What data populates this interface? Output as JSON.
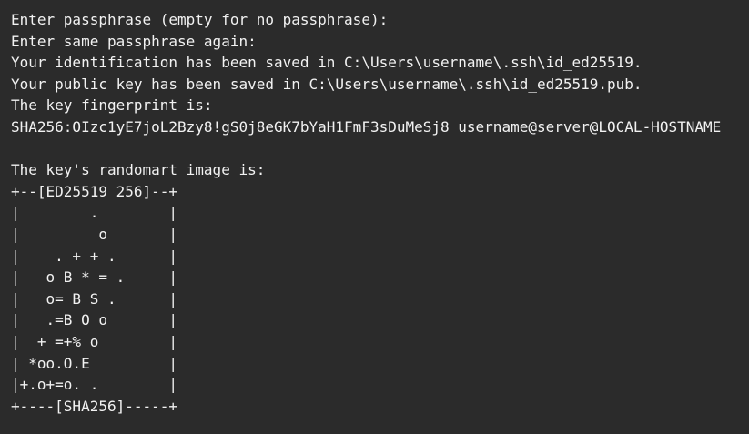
{
  "colors": {
    "background": "#2b2b2b",
    "text": "#f2f2f2"
  },
  "terminal": {
    "lines": [
      "Enter passphrase (empty for no passphrase):",
      "Enter same passphrase again:",
      "Your identification has been saved in C:\\Users\\username\\.ssh\\id_ed25519.",
      "Your public key has been saved in C:\\Users\\username\\.ssh\\id_ed25519.pub.",
      "The key fingerprint is:",
      "SHA256:OIzc1yE7joL2Bzy8!gS0j8eGK7bYaH1FmF3sDuMeSj8 username@server@LOCAL-HOSTNAME",
      "",
      "The key's randomart image is:",
      "+--[ED25519 256]--+",
      "|        .        |",
      "|         o       |",
      "|    . + + .      |",
      "|   o B * = .     |",
      "|   o= B S .      |",
      "|   .=B O o       |",
      "|  + =+% o        |",
      "| *oo.O.E         |",
      "|+.o+=o. .        |",
      "+----[SHA256]-----+"
    ]
  }
}
